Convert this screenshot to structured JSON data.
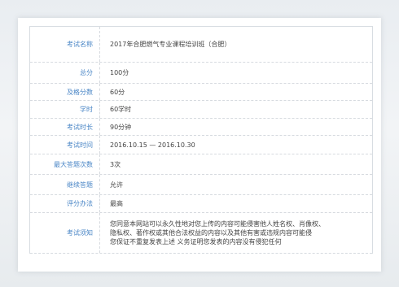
{
  "exam_info": {
    "rows": [
      {
        "label": "考试名称",
        "value": "2017年合肥燃气专业课程培训班（合肥）"
      },
      {
        "label": "总分",
        "value": "100分"
      },
      {
        "label": "及格分数",
        "value": "60分"
      },
      {
        "label": "学时",
        "value": "60学时"
      },
      {
        "label": "考试时长",
        "value": "90分钟"
      },
      {
        "label": "考试时间",
        "value": "2016.10.15 — 2016.10.30"
      },
      {
        "label": "最大答题次数",
        "value": "3次"
      },
      {
        "label": "继续答题",
        "value": "允许"
      },
      {
        "label": "评分办法",
        "value": "最高"
      },
      {
        "label": "考试须知",
        "value_lines": [
          "您同意本网站可以永久性地对您上传的内容可能侵害他人姓名权、肖像权、",
          "隐私权、著作权或其他合法权益的内容以及其他有害或违规内容可能侵",
          "您保证不重复发表上述 义务证明您发表的内容没有侵犯任何"
        ]
      }
    ]
  }
}
